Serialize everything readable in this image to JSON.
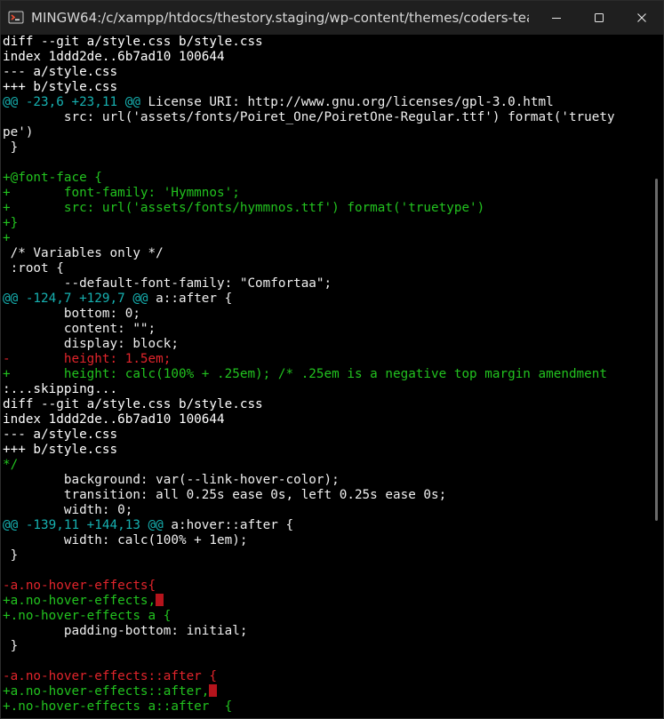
{
  "window": {
    "title": "MINGW64:/c/xampp/htdocs/thestory.staging/wp-content/themes/coders-tea...",
    "minimize_icon": "minimize-icon",
    "maximize_icon": "maximize-icon",
    "close_icon": "close-icon",
    "colors": {
      "meta": "#ffffff",
      "hunk": "#16b0b0",
      "added": "#22c21f",
      "removed": "#e0242b",
      "trailing_whitespace": "#b5141c"
    }
  },
  "terminal": {
    "lines": [
      {
        "type": "meta",
        "text": "diff --git a/style.css b/style.css"
      },
      {
        "type": "meta",
        "text": "index 1ddd2de..6b7ad10 100644"
      },
      {
        "type": "meta",
        "text": "--- a/style.css"
      },
      {
        "type": "meta",
        "text": "+++ b/style.css"
      },
      {
        "type": "hunk",
        "text": "@@ -23,6 +23,11 @@",
        "sig": " License URI: http://www.gnu.org/licenses/gpl-3.0.html"
      },
      {
        "type": "ctx",
        "text": "        src: url('assets/fonts/Poiret_One/PoiretOne-Regular.ttf') format('truety"
      },
      {
        "type": "ctx",
        "text": "pe')"
      },
      {
        "type": "ctx",
        "text": " }"
      },
      {
        "type": "empty",
        "text": ""
      },
      {
        "type": "add",
        "text": "+@font-face {"
      },
      {
        "type": "add",
        "text": "+       font-family: 'Hymmnos';"
      },
      {
        "type": "add",
        "text": "+       src: url('assets/fonts/hymmnos.ttf') format('truetype')"
      },
      {
        "type": "add",
        "text": "+}"
      },
      {
        "type": "add",
        "text": "+"
      },
      {
        "type": "ctx",
        "text": " /* Variables only */"
      },
      {
        "type": "ctx",
        "text": " :root {"
      },
      {
        "type": "ctx",
        "text": "        --default-font-family: \"Comfortaa\";"
      },
      {
        "type": "hunk",
        "text": "@@ -124,7 +129,7 @@",
        "sig": " a::after {"
      },
      {
        "type": "ctx",
        "text": "        bottom: 0;"
      },
      {
        "type": "ctx",
        "text": "        content: \"\";"
      },
      {
        "type": "ctx",
        "text": "        display: block;"
      },
      {
        "type": "del",
        "text": "-       height: 1.5em;"
      },
      {
        "type": "add",
        "text": "+       height: calc(100% + .25em); /* .25em is a negative top margin amendment"
      },
      {
        "type": "pager",
        "text": ":...skipping..."
      },
      {
        "type": "meta",
        "text": "diff --git a/style.css b/style.css"
      },
      {
        "type": "meta",
        "text": "index 1ddd2de..6b7ad10 100644"
      },
      {
        "type": "meta",
        "text": "--- a/style.css"
      },
      {
        "type": "meta",
        "text": "+++ b/style.css"
      },
      {
        "type": "add",
        "text": "*/"
      },
      {
        "type": "ctx",
        "text": "        background: var(--link-hover-color);"
      },
      {
        "type": "ctx",
        "text": "        transition: all 0.25s ease 0s, left 0.25s ease 0s;"
      },
      {
        "type": "ctx",
        "text": "        width: 0;"
      },
      {
        "type": "hunk",
        "text": "@@ -139,11 +144,13 @@",
        "sig": " a:hover::after {"
      },
      {
        "type": "ctx",
        "text": "        width: calc(100% + 1em);"
      },
      {
        "type": "ctx",
        "text": " }"
      },
      {
        "type": "empty",
        "text": ""
      },
      {
        "type": "del",
        "text": "-a.no-hover-effects{"
      },
      {
        "type": "add",
        "text": "+a.no-hover-effects,",
        "ws": true
      },
      {
        "type": "add",
        "text": "+.no-hover-effects a {"
      },
      {
        "type": "ctx",
        "text": "        padding-bottom: initial;"
      },
      {
        "type": "ctx",
        "text": " }"
      },
      {
        "type": "empty",
        "text": ""
      },
      {
        "type": "del",
        "text": "-a.no-hover-effects::after {"
      },
      {
        "type": "add",
        "text": "+a.no-hover-effects::after,",
        "ws": true
      },
      {
        "type": "add",
        "text": "+.no-hover-effects a::after  {"
      }
    ]
  }
}
